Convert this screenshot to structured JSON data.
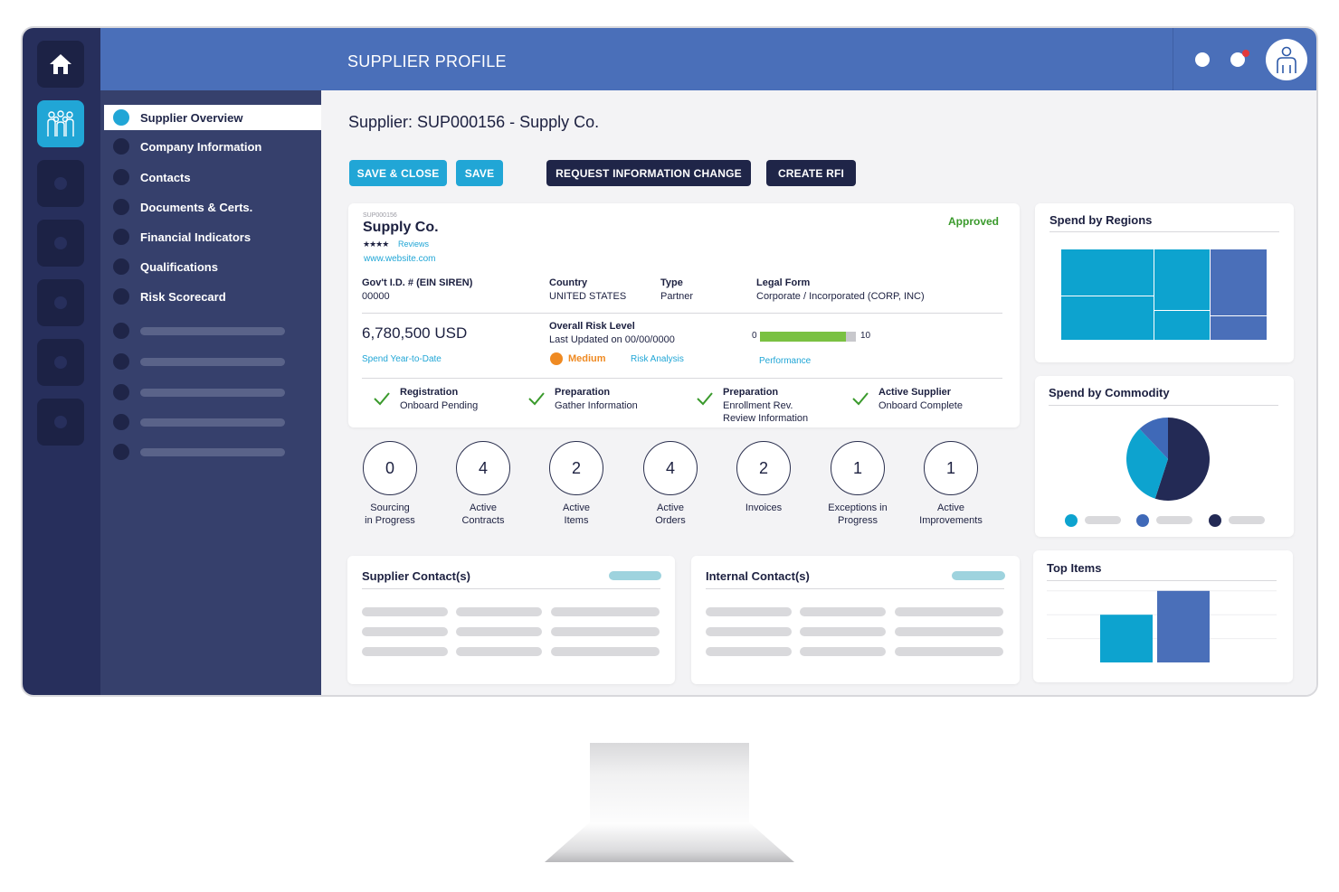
{
  "topbar": {
    "title": "SUPPLIER PROFILE"
  },
  "nav": {
    "items": [
      {
        "label": "Supplier Overview"
      },
      {
        "label": "Company Information"
      },
      {
        "label": "Contacts"
      },
      {
        "label": "Documents & Certs."
      },
      {
        "label": "Financial Indicators"
      },
      {
        "label": "Qualifications"
      },
      {
        "label": "Risk Scorecard"
      }
    ]
  },
  "header": {
    "supplier_title": "Supplier: SUP000156 - Supply Co."
  },
  "actions": {
    "save_close": "SAVE & CLOSE",
    "save": "SAVE",
    "request_change": "REQUEST INFORMATION CHANGE",
    "create_rfi": "CREATE RFI"
  },
  "profile": {
    "id": "SUP000156",
    "name": "Supply Co.",
    "stars": "★★★★",
    "reviews": "Reviews",
    "website": "www.website.com",
    "status": "Approved",
    "status_color": "#3a9a2c",
    "fields": [
      {
        "label": "Gov't I.D. # (EIN SIREN)",
        "value": "00000"
      },
      {
        "label": "Country",
        "value": "UNITED STATES"
      },
      {
        "label": "Type",
        "value": "Partner"
      },
      {
        "label": "Legal Form",
        "value": "Corporate / Incorporated (CORP, INC)"
      }
    ],
    "spend_value": "6,780,500 USD",
    "spend_link": "Spend Year-to-Date",
    "risk_title": "Overall Risk Level",
    "risk_updated": "Last Updated on 00/00/0000",
    "risk_level": "Medium",
    "risk_color": "#ef8a22",
    "risk_link": "Risk Analysis",
    "performance": {
      "min": "0",
      "max": "10",
      "value": 9,
      "fill_color": "#7ac142",
      "link": "Performance"
    }
  },
  "steps": [
    {
      "title": "Registration",
      "lines": [
        "Onboard Pending"
      ]
    },
    {
      "title": "Preparation",
      "lines": [
        "Gather Information"
      ]
    },
    {
      "title": "Preparation",
      "lines": [
        "Enrollment Rev.",
        "Review Information"
      ]
    },
    {
      "title": "Active Supplier",
      "lines": [
        "Onboard Complete"
      ]
    }
  ],
  "stats": [
    {
      "value": "0",
      "label1": "Sourcing",
      "label2": "in Progress"
    },
    {
      "value": "4",
      "label1": "Active",
      "label2": "Contracts"
    },
    {
      "value": "2",
      "label1": "Active",
      "label2": "Items"
    },
    {
      "value": "4",
      "label1": "Active",
      "label2": "Orders"
    },
    {
      "value": "2",
      "label1": "Invoices",
      "label2": ""
    },
    {
      "value": "1",
      "label1": "Exceptions in",
      "label2": "Progress"
    },
    {
      "value": "1",
      "label1": "Active",
      "label2": "Improvements"
    }
  ],
  "contacts": {
    "supplier_title": "Supplier Contact(s)",
    "internal_title": "Internal Contact(s)"
  },
  "widgets": {
    "regions_title": "Spend by Regions",
    "commodity_title": "Spend by Commodity",
    "top_items_title": "Top Items"
  },
  "colors": {
    "navy": "#1f2548",
    "teal": "#21a6d6",
    "blue": "#4a6fb9",
    "cyan": "#0da3cf"
  },
  "chart_data": [
    {
      "type": "pie",
      "title": "Spend by Commodity",
      "slices": [
        {
          "value": 55,
          "color": "#232a55"
        },
        {
          "value": 33,
          "color": "#0da3cf"
        },
        {
          "value": 12,
          "color": "#3f69b8"
        }
      ]
    },
    {
      "type": "bar",
      "title": "Top Items",
      "values": [
        44,
        66
      ],
      "colors": [
        "#0da3cf",
        "#4a6fb9"
      ]
    }
  ]
}
